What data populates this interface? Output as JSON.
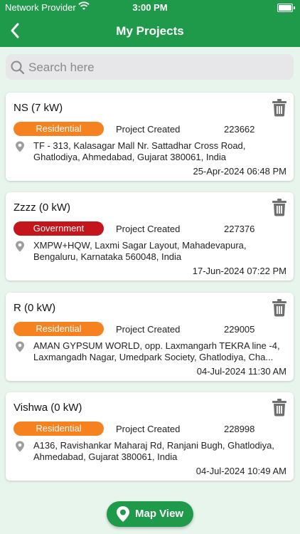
{
  "status_bar": {
    "carrier": "Network Provider",
    "time": "3:00 PM"
  },
  "header": {
    "title": "My Projects"
  },
  "search": {
    "placeholder": "Search here"
  },
  "projects": [
    {
      "name": "NS (7 kW)",
      "category": "Residential",
      "category_color": "#f5821f",
      "status": "Project Created",
      "code": "223662",
      "address": "TF - 313, Kalasagar Mall Nr. Sattadhar Cross Road, Ghatlodiya, Ahmedabad, Gujarat 380061, India",
      "date": "25-Apr-2024 06:48 PM"
    },
    {
      "name": "Zzzz (0 kW)",
      "category": "Government",
      "category_color": "#c4151c",
      "status": "Project Created",
      "code": "227376",
      "address": "XMPW+HQW, Laxmi Sagar Layout, Mahadevapura, Bengaluru, Karnataka 560048, India",
      "date": "17-Jun-2024 07:22 PM"
    },
    {
      "name": "R (0 kW)",
      "category": "Residential",
      "category_color": "#f5821f",
      "status": "Project Created",
      "code": "229005",
      "address": "AMAN GYPSUM WORLD, opp. Laxmangarh TEKRA line -4, Laxmangadh Nagar, Umedpark Society, Ghatlodiya, Cha...",
      "date": "04-Jul-2024 11:30 AM"
    },
    {
      "name": "Vishwa (0 kW)",
      "category": "Residential",
      "category_color": "#f5821f",
      "status": "Project Created",
      "code": "228998",
      "address": "A136, Ravishankar Maharaj Rd, Ranjani Bugh, Ghatlodiya, Ahmedabad, Gujarat 380061, India",
      "date": "04-Jul-2024 10:49 AM"
    }
  ],
  "map_button": {
    "label": "Map View"
  },
  "colors": {
    "brand_green": "#1f9a4b",
    "residential": "#f5821f",
    "government": "#c4151c"
  },
  "icons": {
    "back": "chevron-left-icon",
    "search": "search-icon",
    "delete": "trash-icon",
    "location": "location-pin-icon",
    "map": "map-pin-icon",
    "wifi": "wifi-icon",
    "battery": "battery-icon"
  }
}
